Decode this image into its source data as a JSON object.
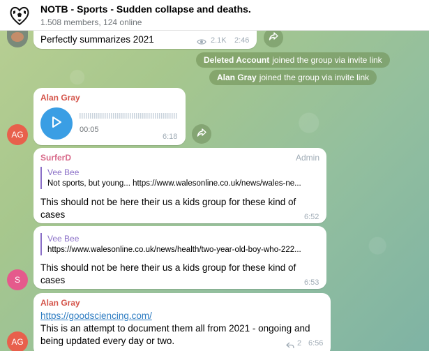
{
  "header": {
    "title": "NOTB - Sports - Sudden collapse and deaths.",
    "subtitle": "1.508 members, 124 online",
    "avatar_icon": "soccer-ball-heart-icon"
  },
  "top_message": {
    "text": "Perfectly summarizes  2021",
    "views": "2.1K",
    "time": "2:46"
  },
  "service_messages": [
    {
      "name": "Deleted Account",
      "text": "joined the group via invite link"
    },
    {
      "name": "Alan Gray",
      "text": "joined the group via invite link"
    }
  ],
  "voice_message": {
    "sender": "Alan Gray",
    "duration": "00:05",
    "time": "6:18",
    "avatar_initials": "AG"
  },
  "surfer_message_1": {
    "sender": "SurferD",
    "badge": "Admin",
    "quote_name": "Vee Bee",
    "quote_text": "Not sports, but young...  https://www.walesonline.co.uk/news/wales-ne...",
    "text": "This should not be here their us a kids group for these kind of cases",
    "time": "6:52"
  },
  "surfer_message_2": {
    "quote_name": "Vee Bee",
    "quote_text": "https://www.walesonline.co.uk/news/health/two-year-old-boy-who-222...",
    "text": "This should not be here their us a kids group for these kind of cases",
    "time": "6:53",
    "avatar_initials": "S"
  },
  "link_message": {
    "sender": "Alan Gray",
    "link": "https://goodsciencing.com/",
    "text": "This is an attempt to document them all from 2021 - ongoing and being updated every day or two.",
    "replies": "2",
    "time": "6:56",
    "avatar_initials": "AG"
  },
  "colors": {
    "avatar_ag": "#e8604c",
    "avatar_s": "#e55a8c",
    "sender_alan": "#d4544a",
    "sender_surfer": "#d86a8a",
    "quote_accent": "#8a6fc7",
    "link": "#2f7dc2",
    "play_button": "#3a9ee4"
  }
}
